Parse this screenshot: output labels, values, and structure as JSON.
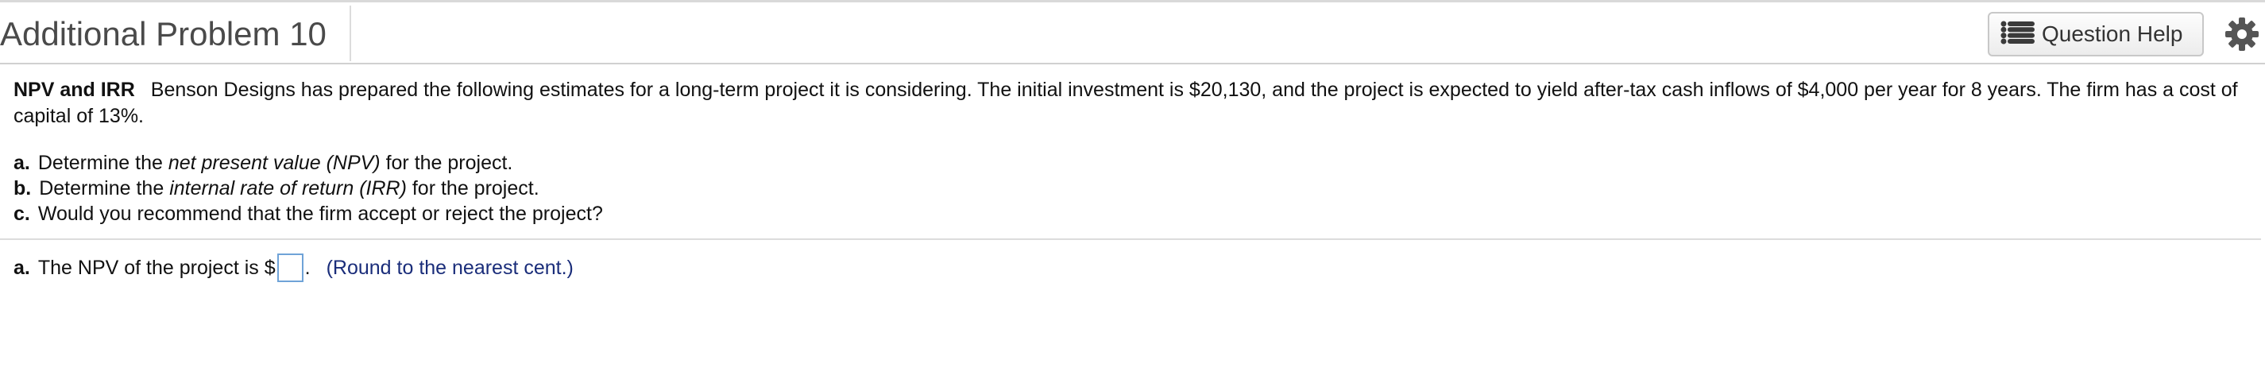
{
  "header": {
    "title": "Additional Problem 10",
    "help_label": "Question Help"
  },
  "problem": {
    "tag": "NPV and IRR",
    "text": "Benson Designs has prepared the following estimates for a long-term project it is considering.  The initial investment is $20,130, and the project is expected to yield after-tax cash inflows of $4,000 per year for 8 years.  The firm has a cost of capital of 13%."
  },
  "questions": [
    {
      "letter": "a.",
      "pre": "Determine the ",
      "em": "net present value (NPV)",
      "post": " for the project."
    },
    {
      "letter": "b.",
      "pre": "Determine the ",
      "em": "internal rate of return (IRR)",
      "post": " for the project."
    },
    {
      "letter": "c.",
      "pre": "Would you recommend that the firm accept or reject the project?",
      "em": "",
      "post": ""
    }
  ],
  "answer": {
    "letter": "a.",
    "prefix": "The NPV of the project is $",
    "value": "",
    "suffix": ".",
    "hint": "(Round to the nearest cent.)"
  },
  "colors": {
    "hint": "#1a2d7a",
    "input_border": "#6fa3d8"
  },
  "icons": {
    "help": "list-icon",
    "settings": "gear-icon"
  }
}
